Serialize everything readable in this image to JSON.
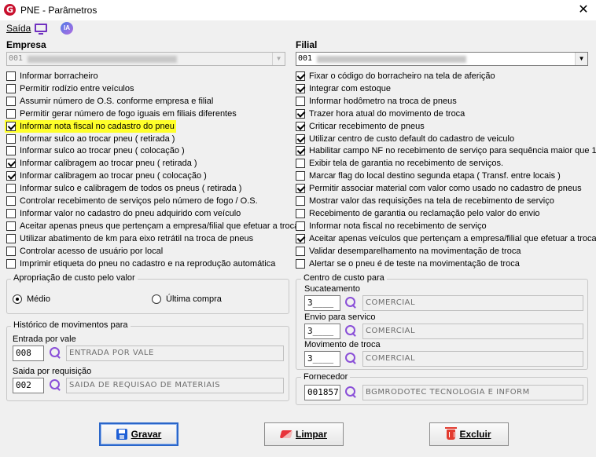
{
  "window": {
    "title": "PNE - Parâmetros",
    "close": "✕",
    "app_icon": "G"
  },
  "menu": {
    "saida": "Saída",
    "ia": "IA"
  },
  "empresa": {
    "label": "Empresa",
    "code": "001",
    "options": [
      {
        "label": "Informar borracheiro",
        "checked": false
      },
      {
        "label": "Permitir rodízio entre veículos",
        "checked": false
      },
      {
        "label": "Assumir número de O.S. conforme empresa e filial",
        "checked": false
      },
      {
        "label": "Permitir gerar número de fogo iguais em filiais diferentes",
        "checked": false
      },
      {
        "label": "Informar nota fiscal no cadastro do pneu",
        "checked": true,
        "highlight": true
      },
      {
        "label": "Informar sulco ao trocar pneu ( retirada )",
        "checked": false
      },
      {
        "label": "Informar sulco ao trocar pneu ( colocação )",
        "checked": false
      },
      {
        "label": "Informar calibragem ao trocar pneu ( retirada )",
        "checked": true
      },
      {
        "label": "Informar calibragem ao trocar pneu ( colocação )",
        "checked": true
      },
      {
        "label": "Informar sulco e calibragem de todos os pneus ( retirada )",
        "checked": false
      },
      {
        "label": "Controlar recebimento de serviços pelo número de fogo / O.S.",
        "checked": false
      },
      {
        "label": "Informar valor no cadastro do pneu adquirido com veículo",
        "checked": false
      },
      {
        "label": "Aceitar apenas pneus que pertençam a empresa/filial que efetuar a troca",
        "checked": false
      },
      {
        "label": "Utilizar abatimento de km para eixo retrátil na troca de pneus",
        "checked": false
      },
      {
        "label": "Controlar acesso de usuário por local",
        "checked": false
      },
      {
        "label": "Imprimir etiqueta do pneu no cadastro e na reprodução automática",
        "checked": false
      }
    ]
  },
  "filial": {
    "label": "Filial",
    "code": "001",
    "options": [
      {
        "label": "Fixar o código do borracheiro na tela de aferição",
        "checked": true
      },
      {
        "label": "Integrar com estoque",
        "checked": true
      },
      {
        "label": "Informar hodômetro na troca de pneus",
        "checked": false
      },
      {
        "label": "Trazer hora atual do movimento de troca",
        "checked": true
      },
      {
        "label": "Criticar recebimento de pneus",
        "checked": true
      },
      {
        "label": "Utilizar centro de custo default do cadastro de veiculo",
        "checked": true
      },
      {
        "label": "Habilitar campo NF no recebimento de serviço para sequência maior que 1",
        "checked": true
      },
      {
        "label": "Exibir tela de garantia no recebimento de serviços.",
        "checked": false
      },
      {
        "label": "Marcar flag do local destino segunda etapa ( Transf. entre locais )",
        "checked": false
      },
      {
        "label": "Permitir associar material com valor como usado no cadastro de pneus",
        "checked": true
      },
      {
        "label": "Mostrar valor das requisições na tela de recebimento de serviço",
        "checked": false
      },
      {
        "label": "Recebimento de garantia ou reclamação pelo valor do envio",
        "checked": false
      },
      {
        "label": "Informar nota fiscal no recebimento de serviço",
        "checked": false
      },
      {
        "label": "Aceitar apenas veículos que pertençam a empresa/filial que efetuar a troca",
        "checked": true
      },
      {
        "label": "Validar desemparelhamento na movimentação de troca",
        "checked": false
      },
      {
        "label": "Alertar se o pneu é de teste na movimentação de troca",
        "checked": false
      }
    ]
  },
  "apropriacao": {
    "title": "Apropriação de custo pelo valor",
    "medio": "Médio",
    "ultima": "Última compra",
    "selected": "medio"
  },
  "historico": {
    "title": "Histórico de movimentos para",
    "entrada_label": "Entrada por vale",
    "entrada_code": "008",
    "entrada_desc": "ENTRADA POR VALE",
    "saida_label": "Saida por requisição",
    "saida_code": "002",
    "saida_desc": "SAIDA DE REQUISAO DE MATERIAIS"
  },
  "centro_custo": {
    "title": "Centro de custo para",
    "sucateamento_label": "Sucateamento",
    "sucateamento_code": "3____",
    "sucateamento_desc": "COMERCIAL",
    "envio_label": "Envio para servico",
    "envio_code": "3____",
    "envio_desc": "COMERCIAL",
    "movimento_label": "Movimento de troca",
    "movimento_code": "3____",
    "movimento_desc": "COMERCIAL"
  },
  "fornecedor": {
    "title": "Fornecedor",
    "code": "001857",
    "desc": "BGMRODOTEC TECNOLOGIA E INFORM"
  },
  "buttons": {
    "gravar": "Gravar",
    "limpar": "Limpar",
    "excluir": "Excluir"
  }
}
